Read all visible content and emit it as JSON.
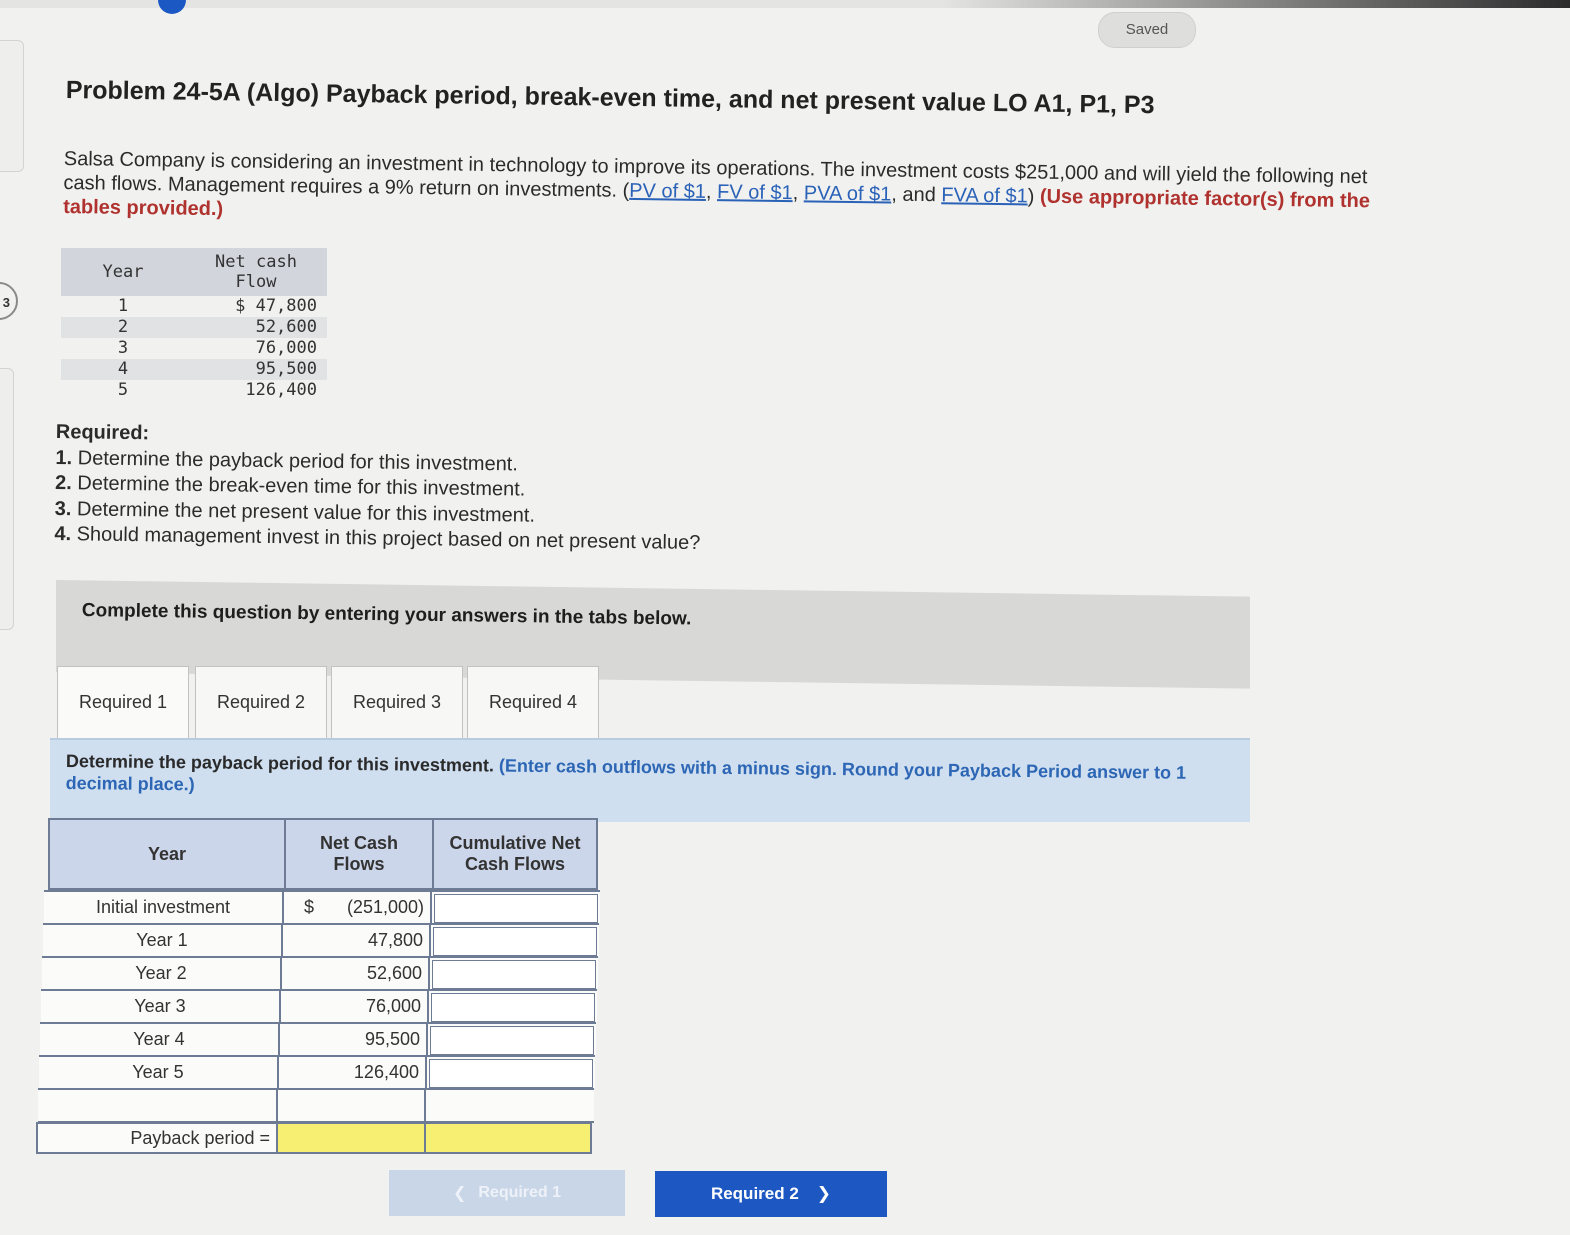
{
  "header": {
    "saved_label": "Saved"
  },
  "problem": {
    "title": "Problem 24-5A (Algo) Payback period, break-even time, and net present value LO A1, P1, P3",
    "intro_text": "Salsa Company is considering an investment in technology to improve its operations. The investment costs $251,000 and will yield the following net cash flows. Management requires a 9% return on investments. (",
    "links": [
      "PV of $1",
      "FV of $1",
      "PVA of $1",
      "FVA of $1"
    ],
    "link_sep_1": ", ",
    "link_sep_2": ", ",
    "link_sep_3": ", and ",
    "link_close": ") ",
    "use_factors": "(Use appropriate factor(s) from the tables provided.)"
  },
  "cash_flow_table": {
    "headers": [
      "Year",
      "Net cash Flow"
    ],
    "rows": [
      {
        "year": "1",
        "flow": "$ 47,800"
      },
      {
        "year": "2",
        "flow": "52,600"
      },
      {
        "year": "3",
        "flow": "76,000"
      },
      {
        "year": "4",
        "flow": "95,500"
      },
      {
        "year": "5",
        "flow": "126,400"
      }
    ]
  },
  "required": {
    "heading": "Required:",
    "items": [
      {
        "num": "1.",
        "text": " Determine the payback period for this investment."
      },
      {
        "num": "2.",
        "text": " Determine the break-even time for this investment."
      },
      {
        "num": "3.",
        "text": " Determine the net present value for this investment."
      },
      {
        "num": "4.",
        "text": " Should management invest in this project based on net present value?"
      }
    ]
  },
  "complete_text": "Complete this question by entering your answers in the tabs below.",
  "tabs": [
    "Required 1",
    "Required 2",
    "Required 3",
    "Required 4"
  ],
  "instruction": {
    "main": "Determine the payback period for this investment. ",
    "hint": "(Enter cash outflows with a minus sign. Round your Payback Period answer to 1 decimal place.)"
  },
  "answer_table": {
    "headers": [
      "Year",
      "Net Cash Flows",
      "Cumulative Net Cash Flows"
    ],
    "currency": "$",
    "rows": [
      {
        "label": "Initial investment",
        "flow": "(251,000)"
      },
      {
        "label": "Year 1",
        "flow": "47,800"
      },
      {
        "label": "Year 2",
        "flow": "52,600"
      },
      {
        "label": "Year 3",
        "flow": "76,000"
      },
      {
        "label": "Year 4",
        "flow": "95,500"
      },
      {
        "label": "Year 5",
        "flow": "126,400"
      }
    ],
    "payback_label": "Payback period ="
  },
  "nav": {
    "prev_label": "Required 1",
    "next_label": "Required 2"
  },
  "colors": {
    "primary_button": "#1d58c2",
    "link": "#2a62b8",
    "highlight_input": "#f6ef72",
    "instruction_bg": "#cfdff0"
  }
}
